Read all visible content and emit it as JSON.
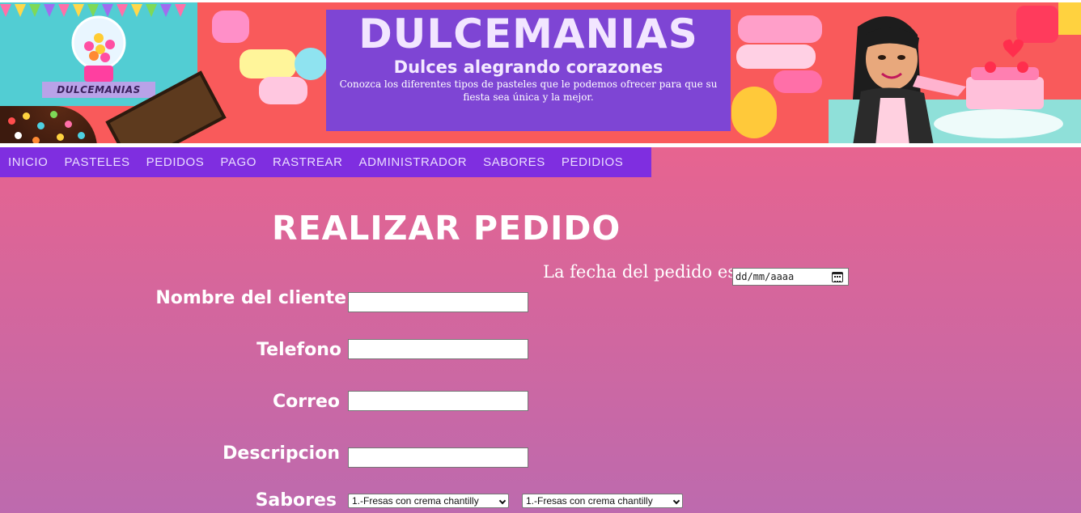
{
  "banner": {
    "logo_text": "DULCEMANIAS",
    "title": "DULCEMANIAS",
    "subtitle": "Dulces alegrando corazones",
    "description": "Conozca los diferentes tipos de pasteles que le podemos ofrecer para que su fiesta sea única y la mejor."
  },
  "nav": {
    "items": [
      {
        "label": "INICIO"
      },
      {
        "label": "PASTELES"
      },
      {
        "label": "PEDIDOS"
      },
      {
        "label": "PAGO"
      },
      {
        "label": "RASTREAR"
      },
      {
        "label": "ADMINISTRADOR"
      },
      {
        "label": "SABORES"
      },
      {
        "label": "PEDIDIOS"
      }
    ]
  },
  "form": {
    "title": "REALIZAR PEDIDO",
    "date_label": "La fecha del pedido es:",
    "date_placeholder": "dd/mm/aaaa",
    "name_label": "Nombre del cliente",
    "phone_label": "Telefono",
    "email_label": "Correo",
    "description_label": "Descripcion",
    "flavors_label": "Sabores",
    "flavor_select_1": "1.-Fresas con crema chantilly",
    "flavor_select_2": "1.-Fresas con crema chantilly"
  },
  "colors": {
    "nav_bg": "#7f2ee0",
    "title_card_bg": "#7343de",
    "page_gradient_top": "#fb6283",
    "page_gradient_bottom": "#bd6aae"
  }
}
